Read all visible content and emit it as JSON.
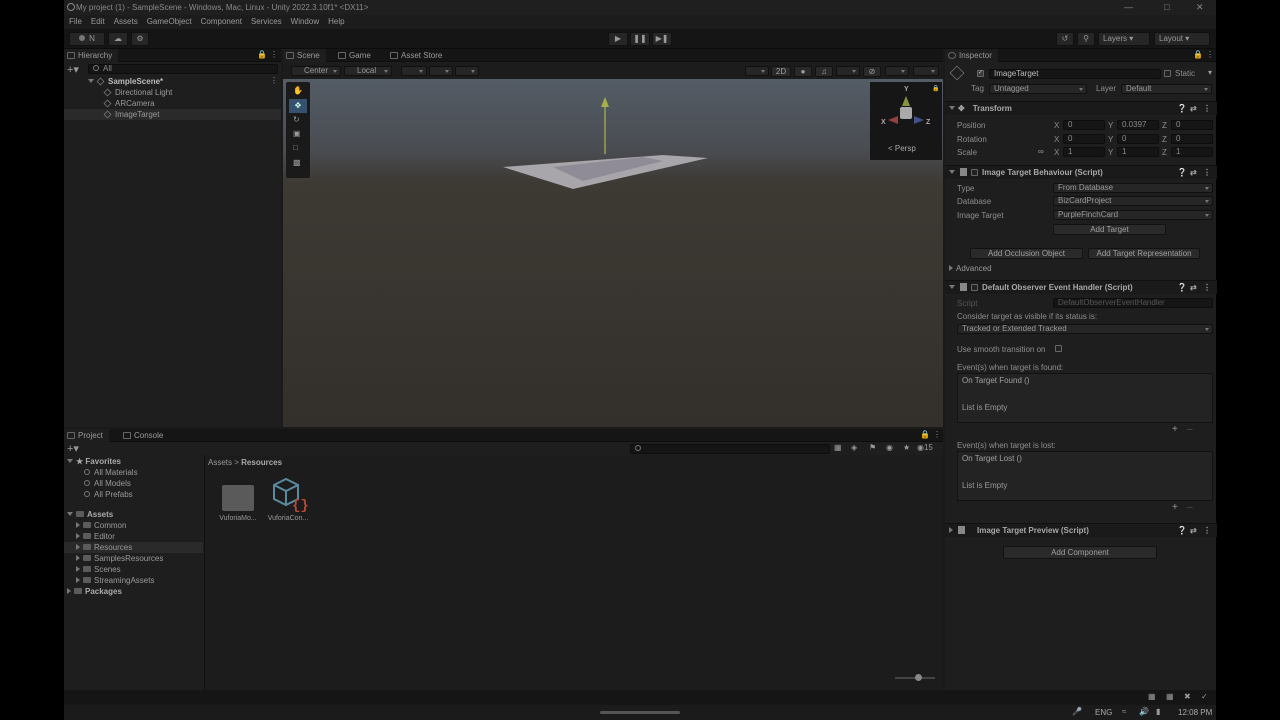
{
  "window": {
    "title": "My project (1) - SampleScene - Windows, Mac, Linux - Unity 2022.3.10f1* <DX11>"
  },
  "menu": [
    "File",
    "Edit",
    "Assets",
    "GameObject",
    "Component",
    "Services",
    "Window",
    "Help"
  ],
  "toolbar": {
    "account": "N",
    "layers": "Layers",
    "layout": "Layout"
  },
  "hierarchy": {
    "tab": "Hierarchy",
    "search_placeholder": "All",
    "scene": "SampleScene*",
    "items": [
      "Directional Light",
      "ARCamera",
      "ImageTarget"
    ]
  },
  "scene": {
    "tabs": [
      "Scene",
      "Game",
      "Asset Store"
    ],
    "pivot": "Center",
    "space": "Local",
    "mode2d": "2D",
    "persp": "< Persp"
  },
  "project": {
    "tabs": [
      "Project",
      "Console"
    ],
    "favorites_label": "Favorites",
    "favorites": [
      "All Materials",
      "All Models",
      "All Prefabs"
    ],
    "assets_label": "Assets",
    "assets": [
      "Common",
      "Editor",
      "Resources",
      "SamplesResources",
      "Scenes",
      "StreamingAssets"
    ],
    "packages_label": "Packages",
    "breadcrumb_root": "Assets",
    "breadcrumb_sep": ">",
    "breadcrumb_current": "Resources",
    "files": [
      "VuforiaMo...",
      "VuforiaCon..."
    ],
    "count": "15"
  },
  "inspector": {
    "tab": "Inspector",
    "object_name": "ImageTarget",
    "static_label": "Static",
    "tag_label": "Tag",
    "tag": "Untagged",
    "layer_label": "Layer",
    "layer": "Default",
    "transform": {
      "title": "Transform",
      "position_label": "Position",
      "rotation_label": "Rotation",
      "scale_label": "Scale",
      "pos": {
        "x": "0",
        "y": "0.0397",
        "z": "0"
      },
      "rot": {
        "x": "0",
        "y": "0",
        "z": "0"
      },
      "scale": {
        "x": "1",
        "y": "1",
        "z": "1"
      }
    },
    "itb": {
      "title": "Image Target Behaviour (Script)",
      "type_label": "Type",
      "type": "From Database",
      "db_label": "Database",
      "db": "BizCardProject",
      "target_label": "Image Target",
      "target": "PurpleFinchCard",
      "add_target": "Add Target",
      "add_occlusion": "Add Occlusion Object",
      "add_representation": "Add Target Representation",
      "advanced": "Advanced"
    },
    "doeh": {
      "title": "Default Observer Event Handler (Script)",
      "script_label": "Script",
      "script": "DefaultObserverEventHandler",
      "consider": "Consider target as visible if its status is:",
      "status": "Tracked or Extended Tracked",
      "smooth": "Use smooth transition on",
      "found_label": "Event(s) when target is found:",
      "found_event": "On Target Found ()",
      "found_empty": "List is Empty",
      "lost_label": "Event(s) when target is lost:",
      "lost_event": "On Target Lost ()",
      "lost_empty": "List is Empty"
    },
    "preview": {
      "title": "Image Target Preview (Script)"
    },
    "add_component": "Add Component"
  },
  "axes": {
    "x": "X",
    "y": "Y",
    "z": "Z"
  },
  "taskbar": {
    "lang": "ENG",
    "time": "12:08 PM"
  }
}
